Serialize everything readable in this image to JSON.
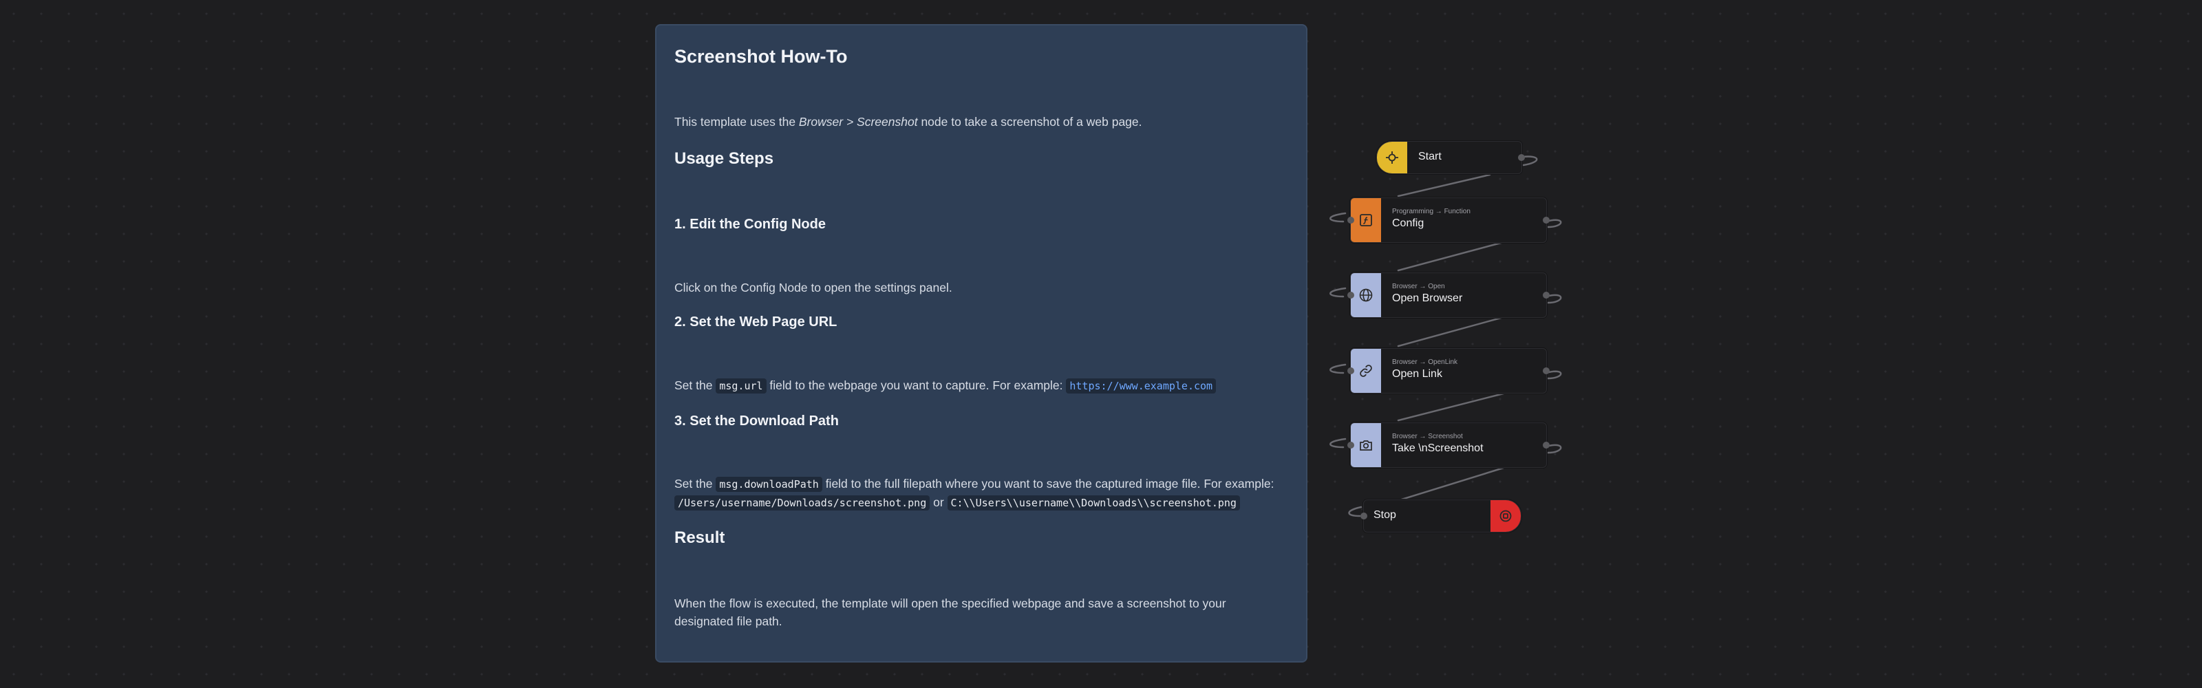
{
  "note": {
    "title": "Screenshot How-To",
    "intro_pre": "This template uses the ",
    "intro_em": "Browser > Screenshot",
    "intro_post": " node to take a screenshot of a web page.",
    "usage_heading": "Usage Steps",
    "step1_heading": "1. Edit the Config Node",
    "step1_text": "Click on the Config Node to open the settings panel.",
    "step2_heading": "2. Set the Web Page URL",
    "step2_pre": "Set the ",
    "step2_code": "msg.url",
    "step2_mid": " field to the webpage you want to capture. For example: ",
    "step2_link": "https://www.example.com",
    "step3_heading": "3. Set the Download Path",
    "step3_pre": "Set the ",
    "step3_code": "msg.downloadPath",
    "step3_mid": " field to the full filepath where you want to save the captured image file. For example: ",
    "step3_path1": "/Users/username/Downloads/screenshot.png",
    "step3_or": " or ",
    "step3_path2": "C:\\\\Users\\\\username\\\\Downloads\\\\screenshot.png",
    "result_heading": "Result",
    "result_text": "When the flow is executed, the template will open the specified webpage and save a screenshot to your designated file path."
  },
  "nodes": {
    "start": {
      "title": "Start",
      "icon": "start-icon",
      "color": "#e3b92c"
    },
    "config": {
      "sub": "Programming → Function",
      "title": "Config",
      "icon": "function-icon",
      "color": "#e07a2c"
    },
    "open_browser": {
      "sub": "Browser → Open",
      "title": "Open Browser",
      "icon": "globe-icon",
      "color": "#a9b6dc"
    },
    "open_link": {
      "sub": "Browser → OpenLink",
      "title": "Open Link",
      "icon": "link-icon",
      "color": "#a9b6dc"
    },
    "screenshot": {
      "sub": "Browser → Screenshot",
      "title": "Take \\nScreenshot",
      "icon": "camera-icon",
      "color": "#a9b6dc"
    },
    "stop": {
      "title": "Stop",
      "icon": "stop-icon",
      "color": "#dd2b2b"
    }
  },
  "colors": {
    "background": "#1e1e20",
    "note": "#2e3e55",
    "link": "#6fa8ff"
  }
}
